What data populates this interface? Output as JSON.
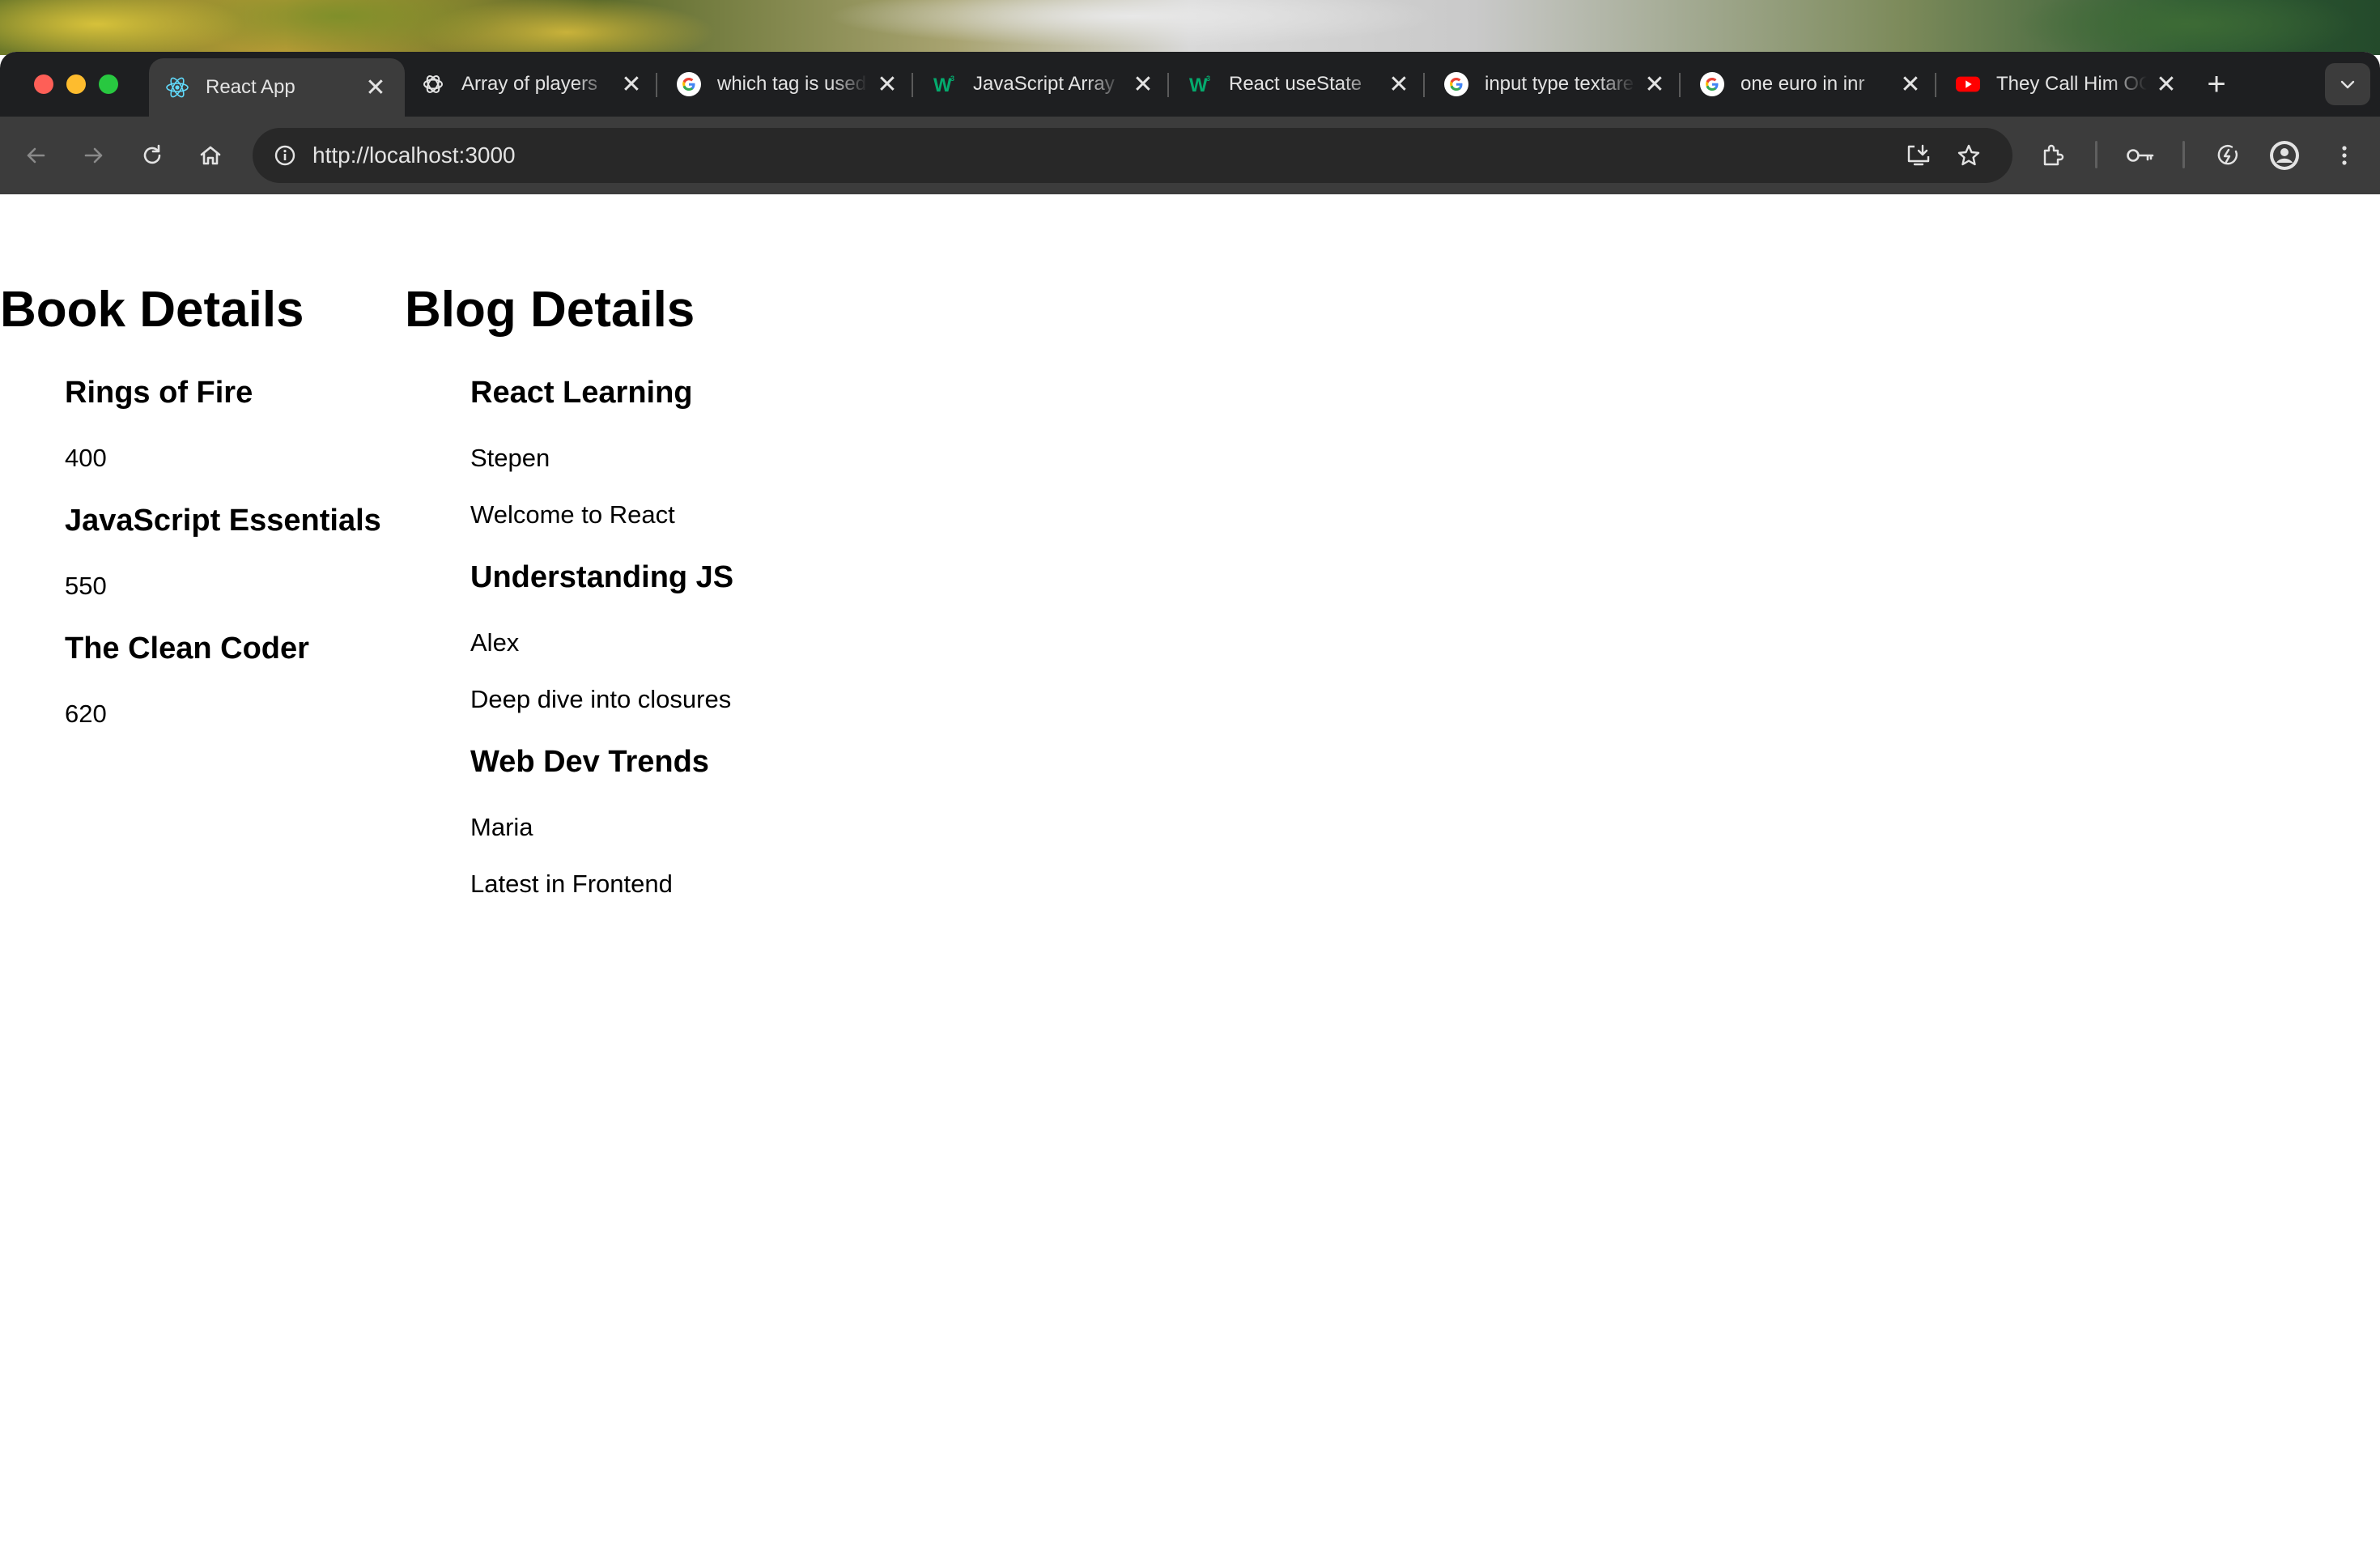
{
  "browser": {
    "tabs": [
      {
        "title": "React App",
        "favicon": "react-icon",
        "active": true
      },
      {
        "title": "Array of players",
        "favicon": "chatgpt-icon",
        "active": false
      },
      {
        "title": "which tag is used",
        "favicon": "google-icon",
        "active": false
      },
      {
        "title": "JavaScript Array",
        "favicon": "w3schools-icon",
        "active": false
      },
      {
        "title": "React useState",
        "favicon": "w3schools-icon",
        "active": false
      },
      {
        "title": "input type textarea",
        "favicon": "google-icon",
        "active": false
      },
      {
        "title": "one euro in inr",
        "favicon": "google-icon",
        "active": false
      },
      {
        "title": "They Call Him OG",
        "favicon": "youtube-icon",
        "active": false
      }
    ],
    "close_glyph": "✕",
    "new_tab_glyph": "+",
    "url": "http://localhost:3000"
  },
  "page": {
    "books": {
      "heading": "Book Details",
      "items": [
        {
          "title": "Rings of Fire",
          "pages": "400"
        },
        {
          "title": "JavaScript Essentials",
          "pages": "550"
        },
        {
          "title": "The Clean Coder",
          "pages": "620"
        }
      ]
    },
    "blogs": {
      "heading": "Blog Details",
      "items": [
        {
          "title": "React Learning",
          "author": "Stepen",
          "content": "Welcome to React"
        },
        {
          "title": "Understanding JS",
          "author": "Alex",
          "content": "Deep dive into closures"
        },
        {
          "title": "Web Dev Trends",
          "author": "Maria",
          "content": "Latest in Frontend"
        }
      ]
    }
  },
  "colors": {
    "tabstrip_bg": "#1e1f21",
    "toolbar_bg": "#3c3c3c",
    "omnibox_bg": "#282828",
    "text_light": "#e3e3e3"
  }
}
